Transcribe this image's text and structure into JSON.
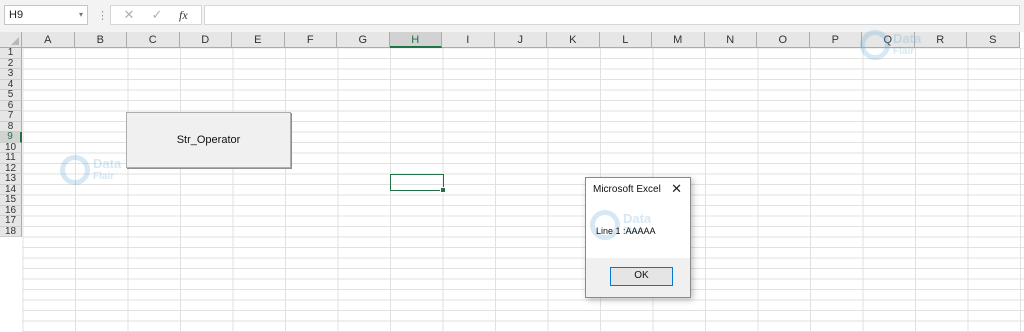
{
  "formula_bar": {
    "name_box": "H9",
    "name_box_dropdown": "▾",
    "separator": "⋮",
    "cancel_glyph": "✕",
    "enter_glyph": "✓",
    "fx_label": "fx",
    "formula_value": ""
  },
  "sheet": {
    "columns": [
      "A",
      "B",
      "C",
      "D",
      "E",
      "F",
      "G",
      "H",
      "I",
      "J",
      "K",
      "L",
      "M",
      "N",
      "O",
      "P",
      "Q",
      "R",
      "S"
    ],
    "rows": [
      "1",
      "2",
      "3",
      "4",
      "5",
      "6",
      "7",
      "8",
      "9",
      "10",
      "11",
      "12",
      "13",
      "14",
      "15",
      "16",
      "17",
      "18"
    ],
    "selected_column": "H",
    "selected_row": "9",
    "selection_color": "#217346"
  },
  "macro_button": {
    "label": "Str_Operator"
  },
  "message_box": {
    "title": "Microsoft Excel",
    "close_glyph": "✕",
    "message": "Line 1 :AAAAA",
    "ok_label": "OK"
  },
  "watermark": {
    "line1": "Data",
    "line2": "Flair",
    "color": "#5aa6d6"
  }
}
